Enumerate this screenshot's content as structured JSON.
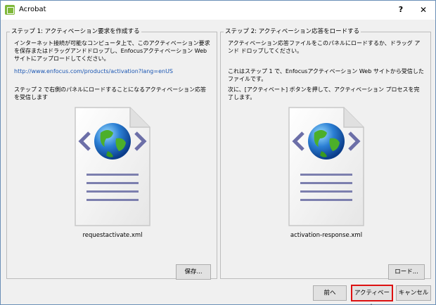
{
  "window": {
    "title": "Acrobat",
    "help_label": "?",
    "close_label": "✕"
  },
  "left": {
    "title": "ステップ 1: アクティベーション要求を作成する",
    "description": "インターネット接続が可能なコンピュータ上で、このアクティベーション要求を保存またはドラッグアンドドロップし、Enfocusアクティベーション Web サイトにアップロードしてください。",
    "url": "http://www.enfocus.com/products/activation?lang=enUS",
    "step_note": "ステップ 2 で右側のパネルにロードすることになるアクティベーション応答を受信します",
    "file_name": "requestactivate.xml",
    "save_label": "保存..."
  },
  "right": {
    "title": "ステップ 2: アクティベーション応答をロードする",
    "description": "アクティベーション応答ファイルをこのパネルにロードするか、ドラッグ アンド ドロップしてください。",
    "note1": "これはステップ 1 で、Enfocusアクティベーション Web サイトから受信したファイルです。",
    "note2": "次に、[アクティベート] ボタンを押して、アクティベーション プロセスを完了します。",
    "file_name": "activation-response.xml",
    "load_label": "ロード..."
  },
  "footer": {
    "back_label": "前へ",
    "activate_label": "アクティベート",
    "cancel_label": "キャンセル"
  },
  "colors": {
    "link": "#1a56b3",
    "highlight_border": "#dd1111"
  },
  "icons": [
    "app-icon",
    "globe-icon",
    "document-icon"
  ]
}
